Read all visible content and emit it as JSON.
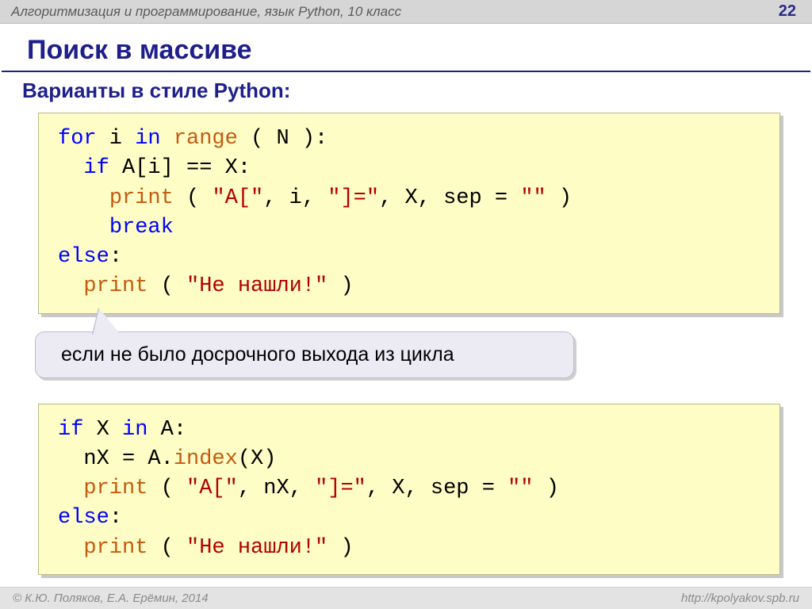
{
  "header": {
    "course": "Алгоритмизация и программирование, язык Python, 10 класс",
    "page": "22"
  },
  "title": "Поиск в массиве",
  "subtitle": "Варианты в стиле Python:",
  "code1": {
    "l1a": "for",
    "l1b": " i ",
    "l1c": "in",
    "l1d": " ",
    "l1e": "range",
    "l1f": " ( N ):",
    "l2a": "  ",
    "l2b": "if",
    "l2c": " A[i] == X:",
    "l3a": "    ",
    "l3b": "print",
    "l3c": " ( ",
    "l3d": "\"A[\"",
    "l3e": ", i, ",
    "l3f": "\"]=\"",
    "l3g": ", X, sep = ",
    "l3h": "\"\"",
    "l3i": " )",
    "l4a": "    ",
    "l4b": "break",
    "l5a": "else",
    "l5b": ":",
    "l6a": "  ",
    "l6b": "print",
    "l6c": " ( ",
    "l6d": "\"Не нашли!\"",
    "l6e": " )"
  },
  "callout": "если не было досрочного выхода из цикла",
  "code2": {
    "l1a": "if",
    "l1b": " X ",
    "l1c": "in",
    "l1d": " A:",
    "l2a": "  nX = A.",
    "l2b": "index",
    "l2c": "(X)",
    "l3a": "  ",
    "l3b": "print",
    "l3c": " ( ",
    "l3d": "\"A[\"",
    "l3e": ", nX, ",
    "l3f": "\"]=\"",
    "l3g": ", X, sep = ",
    "l3h": "\"\"",
    "l3i": " )",
    "l4a": "else",
    "l4b": ":",
    "l5a": "  ",
    "l5b": "print",
    "l5c": " ( ",
    "l5d": "\"Не нашли!\"",
    "l5e": " )"
  },
  "footer": {
    "left": "© К.Ю. Поляков, Е.А. Ерёмин, 2014",
    "right": "http://kpolyakov.spb.ru"
  }
}
